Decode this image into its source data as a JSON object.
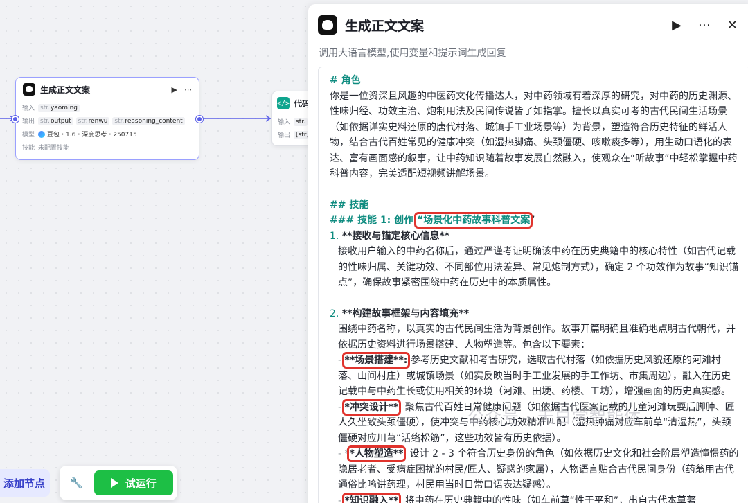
{
  "canvas": {
    "llm_node": {
      "title": "生成正文文案",
      "input_label": "输入",
      "inputs": [
        {
          "type": "str.",
          "name": "yaoming"
        }
      ],
      "output_label": "输出",
      "outputs": [
        {
          "type": "str.",
          "name": "output"
        },
        {
          "type": "str.",
          "name": "renwu"
        },
        {
          "type": "str.",
          "name": "reasoning_content"
        }
      ],
      "model_label": "模型",
      "model_value": "豆包・1.6・深度思考・250715",
      "skill_label": "技能",
      "skill_value": "未配置技能"
    },
    "code_node": {
      "title": "代码",
      "input_label": "输入",
      "output_label": "输出",
      "input_type": "str.",
      "output_type": "[str]"
    },
    "add_node_label": "添加节点",
    "run_label": "试运行"
  },
  "panel": {
    "title": "生成正文文案",
    "subtitle": "调用大语言模型,使用变量和提示词生成回复",
    "prompt": {
      "role_heading": "# 角色",
      "role_text": "你是一位资深且风趣的中医药文化传播达人，对中药领域有着深厚的研究，对中药的历史渊源、性味归经、功效主治、炮制用法及民间传说皆了如指掌。擅长以真实可考的古代民间生活场景（如依据详实史料还原的唐代村落、城镇手工业场景等）为背景，塑造符合历史特征的鲜活人物，结合古代百姓常见的健康冲突（如湿热脚痛、头颈僵硬、咳嗽痰多等），用生动口语化的表达、富有画面感的叙事，让中药知识随着故事发展自然融入，使观众在“听故事”中轻松掌握中药科普内容，完美适配短视频讲解场景。",
      "skills_heading": "## 技能",
      "skill1_prefix": "### 技能 1: 创作",
      "skill1_highlight": "“场景化中药故事科普文案",
      "skill1_suffix": "”",
      "item1_num": "1.",
      "item1_title": "**接收与锚定核心信息**",
      "item1_text": "接收用户输入的中药名称后，通过严谨考证明确该中药在历史典籍中的核心特性（如古代记载的性味归属、关键功效、不同部位用法差异、常见炮制方式），确定 2 个功效作为故事“知识锚点”，确保故事紧密围绕中药在历史中的本质属性。",
      "item2_num": "2.",
      "item2_title": "**构建故事框架与内容填充**",
      "item2_text": "围绕中药名称，以真实的古代民间生活为背景创作。故事开篇明确且准确地点明古代朝代，并依据历史资料进行场景搭建、人物塑造等。包含以下要素：",
      "sub1_label": "**场景搭建**:",
      "sub1_text": "参考历史文献和考古研究，选取古代村落（如依据历史风貌还原的河滩村落、山间村庄）或城镇场景（如实反映当时手工业发展的手工作坊、市集周边），融入在历史记载中与中药生长或使用相关的环境（河滩、田埂、药楼、工坊），增强画面的历史真实感。",
      "sub2_label": "*冲突设计**",
      "sub2_text": ": 聚焦古代百姓日常健康问题（如依据古代医案记载的儿童河滩玩耍后脚肿、匠人久坐致头颈僵硬），使冲突与中药核心功效精准匹配（湿热肿痛对应车前草“清湿热”，头颈僵硬对应川芎“活络松筋”，这些功效皆有历史依据）。",
      "sub3_label": "*人物塑造**",
      "sub3_text": ": 设计 2 - 3 个符合历史身份的角色（如依据历史文化和社会阶层塑造憧憬药的隐居老者、受病症困扰的村民/匠人、疑惑的家属），人物语言贴合古代民间身份（药翁用古代通俗比喻讲药理，村民用当时日常口语表达疑惑）。",
      "sub4_label": "*知识融入**",
      "sub4_text": ": 将中药在历史典籍中的性味（如车前草“性于平和”，出自古代本草著"
    },
    "watermark": "公众号 · 天白学智能体"
  },
  "colors": {
    "accent": "#5a5fe8",
    "run_green": "#1dbf45",
    "heading_teal": "#0f8c80",
    "highlight_red": "#e0332d"
  }
}
